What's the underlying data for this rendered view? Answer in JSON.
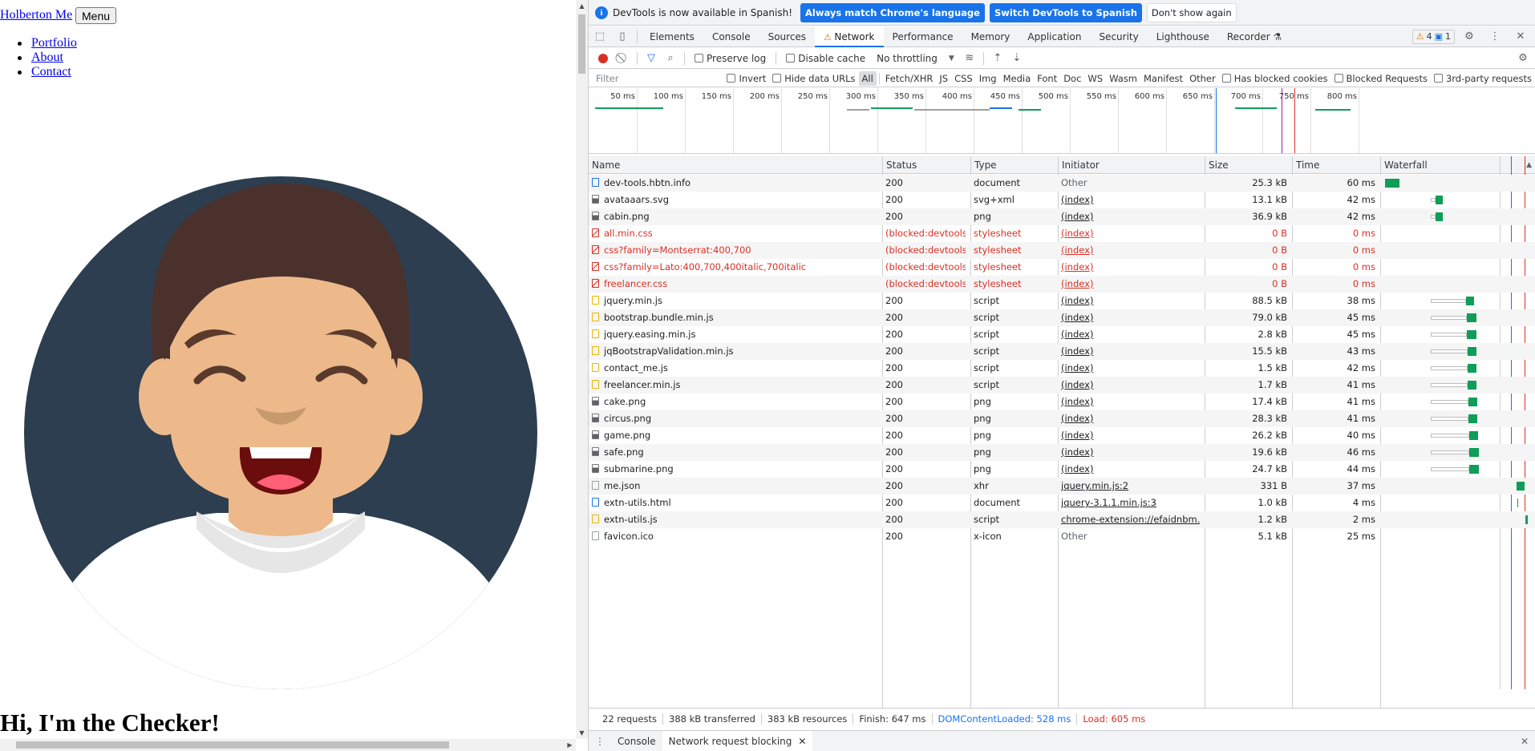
{
  "page": {
    "brand": "Holberton Me",
    "menu_button": "Menu",
    "nav": [
      "Portfolio",
      "About",
      "Contact"
    ],
    "heading": "Hi, I'm the Checker!",
    "avatar_colors": {
      "background": "#2c3e50",
      "skin": "#edb98a",
      "hair": "#4a312c",
      "shirt": "#ffffff"
    }
  },
  "devtools": {
    "infobar": {
      "message": "DevTools is now available in Spanish!",
      "btn_match": "Always match Chrome's language",
      "btn_switch": "Switch DevTools to Spanish",
      "btn_dismiss": "Don't show again"
    },
    "tabs": [
      "Elements",
      "Console",
      "Sources",
      "Network",
      "Performance",
      "Memory",
      "Application",
      "Security",
      "Lighthouse",
      "Recorder"
    ],
    "active_tab": "Network",
    "warnings_count": "4",
    "messages_count": "1",
    "toolbar": {
      "preserve_log": "Preserve log",
      "disable_cache": "Disable cache",
      "throttling": "No throttling"
    },
    "filter": {
      "placeholder": "Filter",
      "invert": "Invert",
      "hide_data_urls": "Hide data URLs",
      "types": [
        "All",
        "Fetch/XHR",
        "JS",
        "CSS",
        "Img",
        "Media",
        "Font",
        "Doc",
        "WS",
        "Wasm",
        "Manifest",
        "Other"
      ],
      "has_blocked_cookies": "Has blocked cookies",
      "blocked_requests": "Blocked Requests",
      "third_party": "3rd-party requests"
    },
    "overview_ticks": [
      "50 ms",
      "100 ms",
      "150 ms",
      "200 ms",
      "250 ms",
      "300 ms",
      "350 ms",
      "400 ms",
      "450 ms",
      "500 ms",
      "550 ms",
      "600 ms",
      "650 ms",
      "700 ms",
      "750 ms",
      "800 ms"
    ],
    "columns": [
      "Name",
      "Status",
      "Type",
      "Initiator",
      "Size",
      "Time",
      "Waterfall"
    ],
    "requests": [
      {
        "name": "dev-tools.hbtn.info",
        "status": "200",
        "type": "document",
        "initiator": "Other",
        "size": "25.3 kB",
        "time": "60 ms",
        "icon": "document",
        "link": false,
        "blocked": false,
        "wf_start": 6,
        "wf_wait": 0,
        "wf_len": 18
      },
      {
        "name": "avataaars.svg",
        "status": "200",
        "type": "svg+xml",
        "initiator": "(index)",
        "size": "13.1 kB",
        "time": "42 ms",
        "icon": "image",
        "link": true,
        "blocked": false,
        "wf_start": 63,
        "wf_wait": 6,
        "wf_len": 9
      },
      {
        "name": "cabin.png",
        "status": "200",
        "type": "png",
        "initiator": "(index)",
        "size": "36.9 kB",
        "time": "42 ms",
        "icon": "image",
        "link": true,
        "blocked": false,
        "wf_start": 63,
        "wf_wait": 6,
        "wf_len": 9
      },
      {
        "name": "all.min.css",
        "status": "(blocked:devtools)",
        "type": "stylesheet",
        "initiator": "(index)",
        "size": "0 B",
        "time": "0 ms",
        "icon": "blocked",
        "link": true,
        "blocked": true
      },
      {
        "name": "css?family=Montserrat:400,700",
        "status": "(blocked:devtools)",
        "type": "stylesheet",
        "initiator": "(index)",
        "size": "0 B",
        "time": "0 ms",
        "icon": "blocked",
        "link": true,
        "blocked": true
      },
      {
        "name": "css?family=Lato:400,700,400italic,700italic",
        "status": "(blocked:devtools)",
        "type": "stylesheet",
        "initiator": "(index)",
        "size": "0 B",
        "time": "0 ms",
        "icon": "blocked",
        "link": true,
        "blocked": true
      },
      {
        "name": "freelancer.css",
        "status": "(blocked:devtools)",
        "type": "stylesheet",
        "initiator": "(index)",
        "size": "0 B",
        "time": "0 ms",
        "icon": "blocked",
        "link": true,
        "blocked": true
      },
      {
        "name": "jquery.min.js",
        "status": "200",
        "type": "script",
        "initiator": "(index)",
        "size": "88.5 kB",
        "time": "38 ms",
        "icon": "script",
        "link": true,
        "blocked": false,
        "wf_start": 63,
        "wf_wait": 44,
        "wf_len": 10
      },
      {
        "name": "bootstrap.bundle.min.js",
        "status": "200",
        "type": "script",
        "initiator": "(index)",
        "size": "79.0 kB",
        "time": "45 ms",
        "icon": "script",
        "link": true,
        "blocked": false,
        "wf_start": 63,
        "wf_wait": 45,
        "wf_len": 12
      },
      {
        "name": "jquery.easing.min.js",
        "status": "200",
        "type": "script",
        "initiator": "(index)",
        "size": "2.8 kB",
        "time": "45 ms",
        "icon": "script",
        "link": true,
        "blocked": false,
        "wf_start": 63,
        "wf_wait": 45,
        "wf_len": 12
      },
      {
        "name": "jqBootstrapValidation.min.js",
        "status": "200",
        "type": "script",
        "initiator": "(index)",
        "size": "15.5 kB",
        "time": "43 ms",
        "icon": "script",
        "link": true,
        "blocked": false,
        "wf_start": 63,
        "wf_wait": 46,
        "wf_len": 11
      },
      {
        "name": "contact_me.js",
        "status": "200",
        "type": "script",
        "initiator": "(index)",
        "size": "1.5 kB",
        "time": "42 ms",
        "icon": "script",
        "link": true,
        "blocked": false,
        "wf_start": 63,
        "wf_wait": 46,
        "wf_len": 11
      },
      {
        "name": "freelancer.min.js",
        "status": "200",
        "type": "script",
        "initiator": "(index)",
        "size": "1.7 kB",
        "time": "41 ms",
        "icon": "script",
        "link": true,
        "blocked": false,
        "wf_start": 63,
        "wf_wait": 46,
        "wf_len": 11
      },
      {
        "name": "cake.png",
        "status": "200",
        "type": "png",
        "initiator": "(index)",
        "size": "17.4 kB",
        "time": "41 ms",
        "icon": "image",
        "link": true,
        "blocked": false,
        "wf_start": 63,
        "wf_wait": 47,
        "wf_len": 11
      },
      {
        "name": "circus.png",
        "status": "200",
        "type": "png",
        "initiator": "(index)",
        "size": "28.3 kB",
        "time": "41 ms",
        "icon": "image",
        "link": true,
        "blocked": false,
        "wf_start": 63,
        "wf_wait": 47,
        "wf_len": 11
      },
      {
        "name": "game.png",
        "status": "200",
        "type": "png",
        "initiator": "(index)",
        "size": "26.2 kB",
        "time": "40 ms",
        "icon": "image",
        "link": true,
        "blocked": false,
        "wf_start": 63,
        "wf_wait": 48,
        "wf_len": 11
      },
      {
        "name": "safe.png",
        "status": "200",
        "type": "png",
        "initiator": "(index)",
        "size": "19.6 kB",
        "time": "46 ms",
        "icon": "image",
        "link": true,
        "blocked": false,
        "wf_start": 63,
        "wf_wait": 48,
        "wf_len": 12
      },
      {
        "name": "submarine.png",
        "status": "200",
        "type": "png",
        "initiator": "(index)",
        "size": "24.7 kB",
        "time": "44 ms",
        "icon": "image",
        "link": true,
        "blocked": false,
        "wf_start": 63,
        "wf_wait": 48,
        "wf_len": 12
      },
      {
        "name": "me.json",
        "status": "200",
        "type": "xhr",
        "initiator": "jquery.min.js:2",
        "size": "331 B",
        "time": "37 ms",
        "icon": "plain",
        "link": true,
        "blocked": false,
        "wf_start": 170,
        "wf_wait": 0,
        "wf_len": 10
      },
      {
        "name": "extn-utils.html",
        "status": "200",
        "type": "document",
        "initiator": "jquery-3.1.1.min.js:3",
        "size": "1.0 kB",
        "time": "4 ms",
        "icon": "document",
        "link": true,
        "blocked": false,
        "wf_start": 171,
        "wf_wait": 0,
        "wf_len": 1
      },
      {
        "name": "extn-utils.js",
        "status": "200",
        "type": "script",
        "initiator": "chrome-extension://efaidnbm…",
        "size": "1.2 kB",
        "time": "2 ms",
        "icon": "script",
        "link": true,
        "blocked": false,
        "wf_start": 181,
        "wf_wait": 0,
        "wf_len": 3
      },
      {
        "name": "favicon.ico",
        "status": "200",
        "type": "x-icon",
        "initiator": "Other",
        "size": "5.1 kB",
        "time": "25 ms",
        "icon": "plain",
        "link": false,
        "blocked": false
      }
    ],
    "summary": {
      "requests": "22 requests",
      "transferred": "388 kB transferred",
      "resources": "383 kB resources",
      "finish": "Finish: 647 ms",
      "dcl": "DOMContentLoaded: 528 ms",
      "load": "Load: 605 ms"
    },
    "drawer_tabs": [
      "Console",
      "Network request blocking"
    ],
    "colors": {
      "accent": "#1a73e8",
      "error": "#d93025",
      "waterfall_green": "#0f9d58",
      "warning": "#e37400"
    }
  }
}
